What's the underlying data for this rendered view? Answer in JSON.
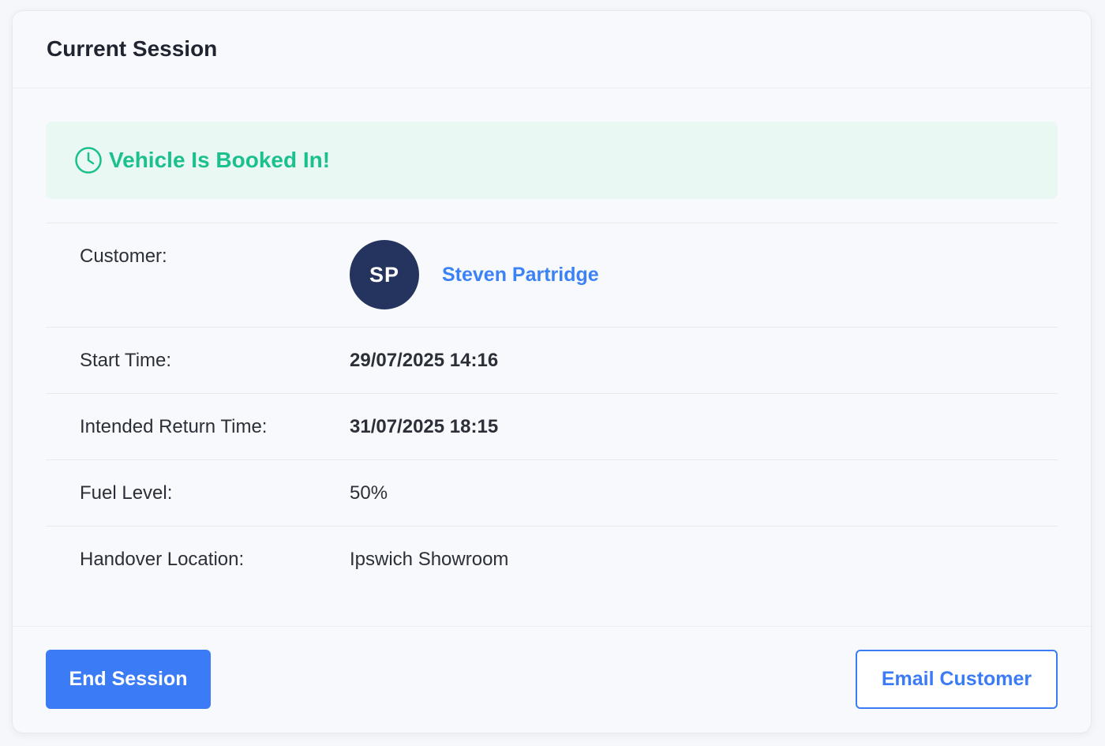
{
  "card": {
    "title": "Current Session"
  },
  "alert": {
    "icon": "clock-icon",
    "text": "Vehicle Is Booked In!",
    "color": "#1cc08f",
    "background": "#eaf8f3"
  },
  "details": {
    "customer": {
      "label": "Customer:",
      "initials": "SP",
      "name": "Steven Partridge"
    },
    "start_time": {
      "label": "Start Time:",
      "value": "29/07/2025 14:16"
    },
    "return_time": {
      "label": "Intended Return Time:",
      "value": "31/07/2025 18:15"
    },
    "fuel_level": {
      "label": "Fuel Level:",
      "value": "50%"
    },
    "handover_location": {
      "label": "Handover Location:",
      "value": "Ipswich Showroom"
    }
  },
  "footer": {
    "end_session_label": "End Session",
    "email_customer_label": "Email Customer"
  },
  "colors": {
    "accent": "#3b7cf6",
    "avatar_bg": "#24345e",
    "success": "#1cc08f"
  }
}
